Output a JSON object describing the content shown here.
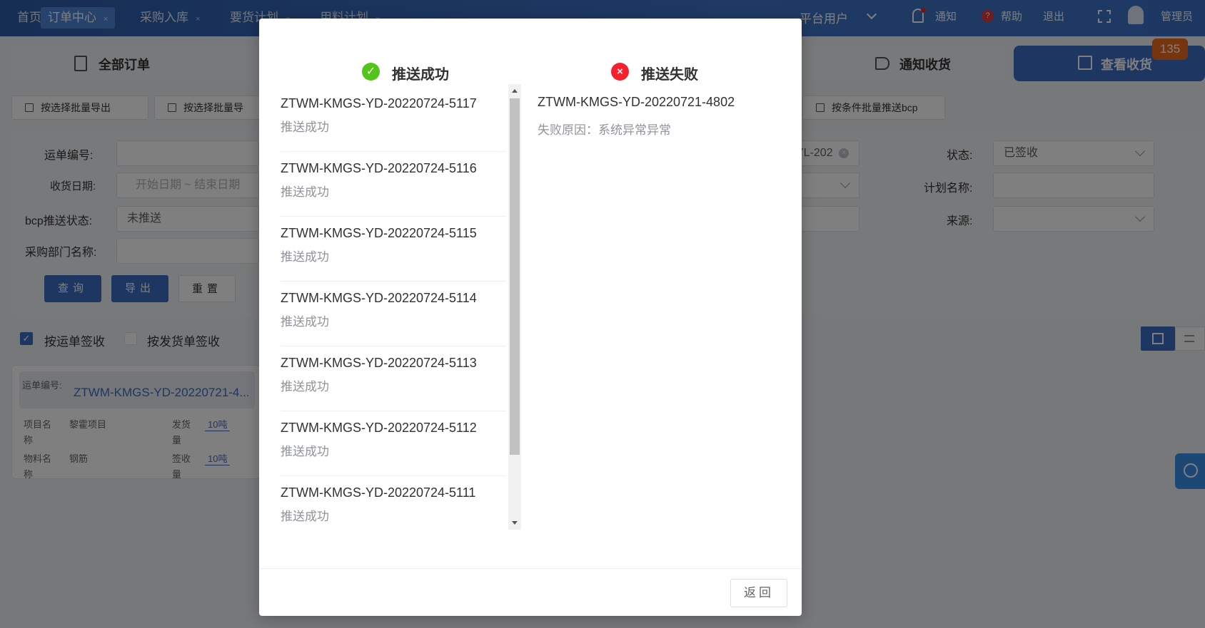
{
  "topbar": {
    "tabs": [
      {
        "label": "首页"
      },
      {
        "label": "订单中心"
      },
      {
        "label": "采购入库"
      },
      {
        "label": "要货计划"
      },
      {
        "label": "用料计划"
      }
    ],
    "close_glyph": "×",
    "user_type": "平台用户",
    "notify": "通知",
    "help": "帮助",
    "logout": "退出",
    "admin": "管理员"
  },
  "bg": {
    "tab_all_orders": "全部订单",
    "tab_notify": "通知收货",
    "tab_view": "查看收货",
    "badge": "135",
    "export_selected": "按选择批量导出",
    "export_selected2": "按选择批量导",
    "push_bcp": "按条件批量推送bcp",
    "waybill_label": "运单编号:",
    "date_label": "收货日期:",
    "date_start": "开始日期",
    "date_sep": "~",
    "date_end": "结束日期",
    "bcp_label": "bcp推送状态:",
    "bcp_value": "未推送",
    "dept_label": "采购部门名称:",
    "partial_code": "YL-202",
    "status_label": "状态:",
    "status_value": "已签收",
    "plan_label": "计划名称:",
    "source_label": "来源:",
    "btn_query": "查询",
    "btn_export": "导出",
    "btn_reset": "重置",
    "chk_waybill": "按运单签收",
    "chk_delivery": "按发货单签收",
    "card_waybill_label": "运单编号:",
    "card_waybill_value": "ZTWM-KMGS-YD-20220721-4...",
    "card_proj_label": "项目名称",
    "card_proj_value": "黎霍项目",
    "card_ship_label": "发货量",
    "card_ship_value": "10吨",
    "card_mat_label": "物料名称",
    "card_mat_value": "钢筋",
    "card_recv_label": "签收量",
    "card_recv_value": "10吨"
  },
  "modal": {
    "success_title": "推送成功",
    "fail_title": "推送失败",
    "success_items": [
      {
        "code": "ZTWM-KMGS-YD-20220724-5117",
        "status": "推送成功"
      },
      {
        "code": "ZTWM-KMGS-YD-20220724-5116",
        "status": "推送成功"
      },
      {
        "code": "ZTWM-KMGS-YD-20220724-5115",
        "status": "推送成功"
      },
      {
        "code": "ZTWM-KMGS-YD-20220724-5114",
        "status": "推送成功"
      },
      {
        "code": "ZTWM-KMGS-YD-20220724-5113",
        "status": "推送成功"
      },
      {
        "code": "ZTWM-KMGS-YD-20220724-5112",
        "status": "推送成功"
      },
      {
        "code": "ZTWM-KMGS-YD-20220724-5111",
        "status": "推送成功"
      }
    ],
    "fail_items": [
      {
        "code": "ZTWM-KMGS-YD-20220721-4802",
        "reason": "失败原因：系统异常异常"
      }
    ],
    "back_button": "返回"
  },
  "colors": {
    "primary": "#3a6fc4",
    "success": "#52c41a",
    "danger": "#f5222d"
  }
}
